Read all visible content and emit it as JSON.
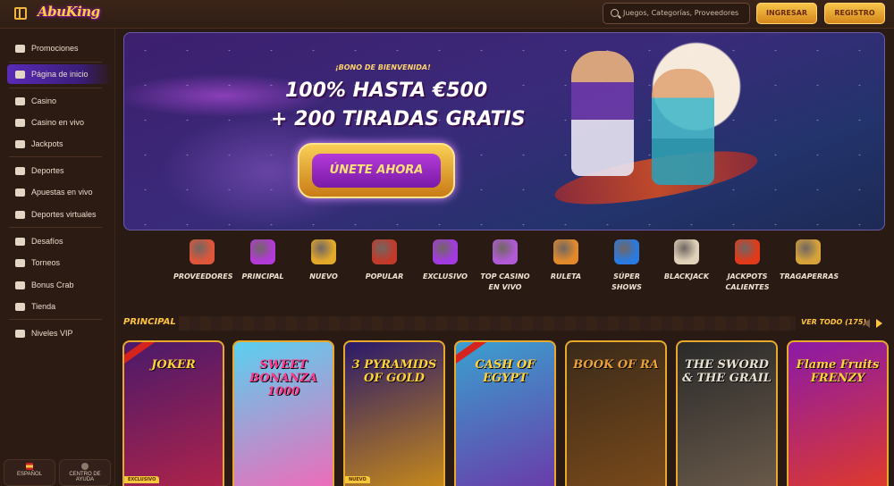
{
  "header": {
    "logo_text": "AbuKing",
    "search_placeholder": "Juegos, Categorías, Proveedores",
    "login_label": "INGRESAR",
    "register_label": "REGISTRO"
  },
  "sidebar": {
    "items": [
      {
        "label": "Promociones",
        "icon": "gift-icon"
      },
      {
        "label": "Página de inicio",
        "icon": "home-icon",
        "active": true
      },
      {
        "label": "Casino",
        "icon": "slot-machine-icon"
      },
      {
        "label": "Casino en vivo",
        "icon": "live-dealer-icon"
      },
      {
        "label": "Jackpots",
        "icon": "clover-icon"
      },
      {
        "label": "Deportes",
        "icon": "sports-icon"
      },
      {
        "label": "Apuestas en vivo",
        "icon": "live-bet-icon"
      },
      {
        "label": "Deportes virtuales",
        "icon": "virtual-sports-icon"
      },
      {
        "label": "Desafíos",
        "icon": "challenge-icon"
      },
      {
        "label": "Torneos",
        "icon": "trophy-icon"
      },
      {
        "label": "Bonus Crab",
        "icon": "crab-icon"
      },
      {
        "label": "Tienda",
        "icon": "store-icon"
      },
      {
        "label": "Niveles VIP",
        "icon": "diamond-icon"
      }
    ],
    "footer": {
      "language_label": "ESPAÑOL",
      "help_label_1": "CENTRO DE",
      "help_label_2": "AYUDA"
    }
  },
  "banner": {
    "kicker": "¡BONO DE BIENVENIDA!",
    "line1": "100% HASTA €500",
    "line2": "+ 200 TIRADAS GRATIS",
    "cta_label": "ÚNETE AHORA"
  },
  "categories": [
    {
      "label": "PROVEEDORES",
      "icon": "scroll-icon",
      "color": "#e0563a"
    },
    {
      "label": "PRINCIPAL",
      "icon": "star-icon",
      "color": "#b23ad6"
    },
    {
      "label": "NUEVO",
      "icon": "lamp-icon",
      "color": "#e2a82a"
    },
    {
      "label": "POPULAR",
      "icon": "carpet-icon",
      "color": "#c23a2a"
    },
    {
      "label": "EXCLUSIVO",
      "icon": "gem-icon",
      "color": "#a33ae0"
    },
    {
      "label": "TOP CASINO EN VIVO",
      "icon": "chips-icon",
      "color": "#b05ad6"
    },
    {
      "label": "RULETA",
      "icon": "roulette-icon",
      "color": "#e28a2a"
    },
    {
      "label": "SÚPER SHOWS",
      "icon": "wheel-icon",
      "color": "#2a7ae0"
    },
    {
      "label": "BLACKJACK",
      "icon": "cards-icon",
      "color": "#e0d2b8"
    },
    {
      "label": "JACKPOTS CALIENTES",
      "icon": "chili-icon",
      "color": "#e03a1a"
    },
    {
      "label": "TRAGAPERRAS",
      "icon": "slot-icon",
      "color": "#d6a23a"
    }
  ],
  "section": {
    "title": "PRINCIPAL",
    "view_all": "VER TODO (175)"
  },
  "games": [
    {
      "title": "JOKER",
      "tag": "EXCLUSIVO",
      "ribbon": true,
      "bg1": "#4a1a6a",
      "bg2": "#b0234a",
      "text_color": "#ffd23a"
    },
    {
      "title": "SWEET BONANZA 1000",
      "tag": "",
      "ribbon": false,
      "bg1": "#5ad0f0",
      "bg2": "#f06ab8",
      "text_color": "#ff3a8a"
    },
    {
      "title": "3 PYRAMIDS OF GOLD",
      "tag": "NUEVO",
      "ribbon": false,
      "bg1": "#2a1a6a",
      "bg2": "#c88a1a",
      "text_color": "#ffd23a"
    },
    {
      "title": "CASH OF EGYPT",
      "tag": "",
      "ribbon": true,
      "bg1": "#3aa0d0",
      "bg2": "#6a3aa8",
      "text_color": "#ffd23a"
    },
    {
      "title": "BOOK OF RA",
      "tag": "",
      "ribbon": false,
      "bg1": "#3a2a1a",
      "bg2": "#7a4a1a",
      "text_color": "#e8a03a"
    },
    {
      "title": "THE SWORD & THE GRAIL",
      "tag": "",
      "ribbon": false,
      "bg1": "#2a2a2a",
      "bg2": "#6a5a4a",
      "text_color": "#e8e0d0"
    },
    {
      "title": "Flame Fruits FRENZY",
      "tag": "",
      "ribbon": false,
      "bg1": "#8a1aa8",
      "bg2": "#e03a2a",
      "text_color": "#ffd23a"
    }
  ]
}
